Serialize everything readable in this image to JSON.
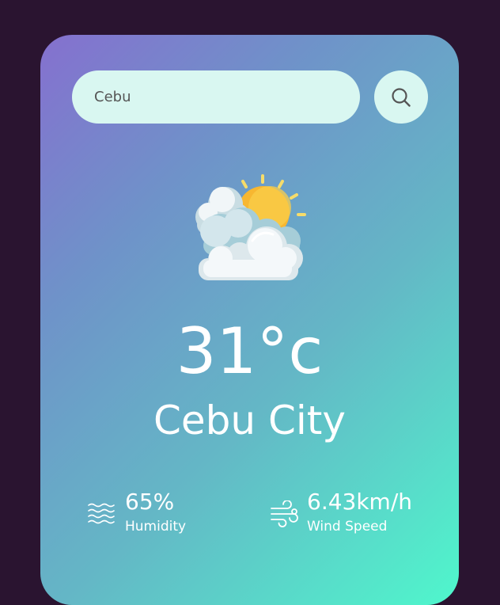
{
  "search": {
    "value": "Cebu",
    "button_icon": "search-icon"
  },
  "weather": {
    "condition_icon": "partly-cloudy-sun-icon",
    "temperature": "31°c",
    "city": "Cebu City"
  },
  "details": {
    "humidity": {
      "icon": "humidity-waves-icon",
      "value": "65%",
      "label": "Humidity"
    },
    "wind": {
      "icon": "wind-icon",
      "value": "6.43km/h",
      "label": "Wind Speed"
    }
  },
  "colors": {
    "page_background": "#2a1430",
    "card_gradient_top_right": "#8570cf",
    "card_gradient_bottom_left": "#4ff7cc",
    "input_background": "#d9f7f1",
    "text": "#ffffff"
  }
}
